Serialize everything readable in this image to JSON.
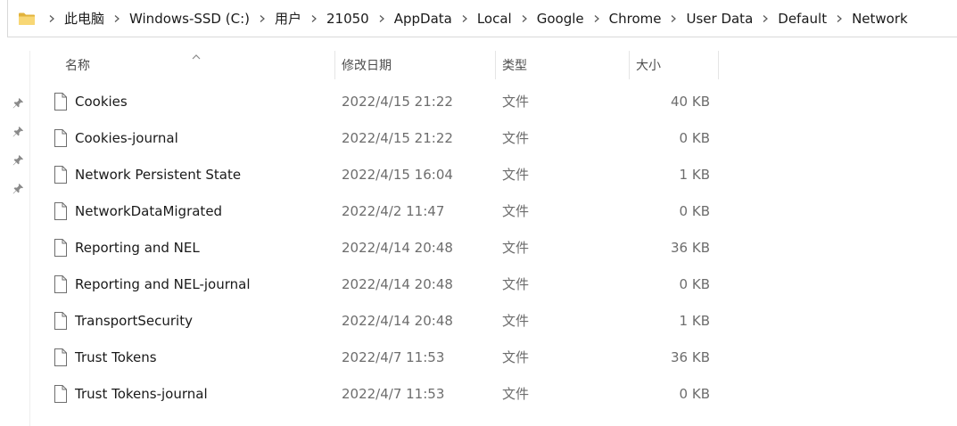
{
  "breadcrumb": {
    "items": [
      "此电脑",
      "Windows-SSD (C:)",
      "用户",
      "21050",
      "AppData",
      "Local",
      "Google",
      "Chrome",
      "User Data",
      "Default",
      "Network"
    ]
  },
  "columns": {
    "name": "名称",
    "date": "修改日期",
    "type": "类型",
    "size": "大小"
  },
  "files": [
    {
      "name": "Cookies",
      "date": "2022/4/15 21:22",
      "type": "文件",
      "size": "40 KB"
    },
    {
      "name": "Cookies-journal",
      "date": "2022/4/15 21:22",
      "type": "文件",
      "size": "0 KB"
    },
    {
      "name": "Network Persistent State",
      "date": "2022/4/15 16:04",
      "type": "文件",
      "size": "1 KB"
    },
    {
      "name": "NetworkDataMigrated",
      "date": "2022/4/2 11:47",
      "type": "文件",
      "size": "0 KB"
    },
    {
      "name": "Reporting and NEL",
      "date": "2022/4/14 20:48",
      "type": "文件",
      "size": "36 KB"
    },
    {
      "name": "Reporting and NEL-journal",
      "date": "2022/4/14 20:48",
      "type": "文件",
      "size": "0 KB"
    },
    {
      "name": "TransportSecurity",
      "date": "2022/4/14 20:48",
      "type": "文件",
      "size": "1 KB"
    },
    {
      "name": "Trust Tokens",
      "date": "2022/4/7 11:53",
      "type": "文件",
      "size": "36 KB"
    },
    {
      "name": "Trust Tokens-journal",
      "date": "2022/4/7 11:53",
      "type": "文件",
      "size": "0 KB"
    }
  ],
  "icons": {
    "folder": "folder-icon",
    "separator": "chevron-right-icon",
    "pin": "pin-icon",
    "file": "file-icon",
    "sort": "sort-ascending-icon"
  },
  "colors": {
    "folder_yellow": "#f8d775",
    "folder_dark": "#e2b33c",
    "pin_gray": "#8a8a8a"
  }
}
